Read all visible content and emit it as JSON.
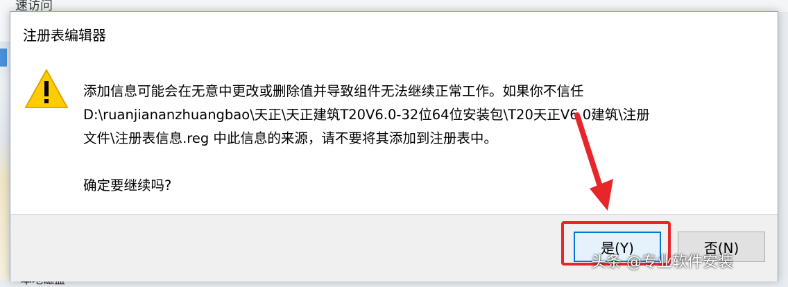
{
  "background": {
    "window_title": "快速访问",
    "bottom_text": "本地磁盘"
  },
  "dialog": {
    "title": "注册表编辑器",
    "message_lines": [
      "添加信息可能会在无意中更改或删除值并导致组件无法继续正常工作。如果你不信任",
      "D:\\ruanjiananzhuangbao\\天正\\天正建筑T20V6.0-32位64位安装包\\T20天正V6.0建筑\\注册",
      "文件\\注册表信息.reg 中此信息的来源，请不要将其添加到注册表中。"
    ],
    "question": "确定要继续吗?",
    "buttons": {
      "yes_label": "是(Y)",
      "no_label": "否(N)"
    },
    "icon": "warning-icon"
  },
  "annotation": {
    "highlight_color": "#e8262a",
    "watermark": "头条 @专业软件安装"
  },
  "colors": {
    "accent": "#0078d7",
    "warning_yellow": "#ffcc00"
  }
}
